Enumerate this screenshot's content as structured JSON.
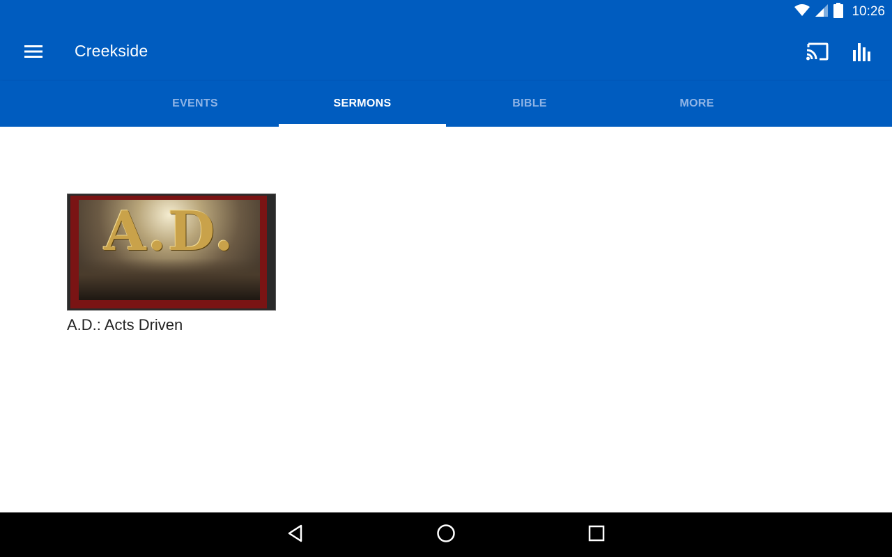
{
  "status_bar": {
    "time": "10:26",
    "icons": [
      "wifi-icon",
      "cell-signal-icon",
      "battery-icon"
    ]
  },
  "app_bar": {
    "title": "Creekside",
    "icons": [
      "menu-icon",
      "cast-icon",
      "bar-chart-icon"
    ]
  },
  "tabs": [
    {
      "label": "EVENTS",
      "active": false
    },
    {
      "label": "SERMONS",
      "active": true
    },
    {
      "label": "BIBLE",
      "active": false
    },
    {
      "label": "MORE",
      "active": false
    }
  ],
  "sermons": [
    {
      "title": "A.D.: Acts Driven",
      "thumbnail_text": "A.D."
    }
  ],
  "nav_bar": {
    "icons": [
      "back-icon",
      "home-icon",
      "recents-icon"
    ]
  },
  "colors": {
    "primary": "#005cbf",
    "tab_inactive": "#8fb4e6",
    "tab_active": "#ffffff",
    "nav_bar": "#000000"
  }
}
